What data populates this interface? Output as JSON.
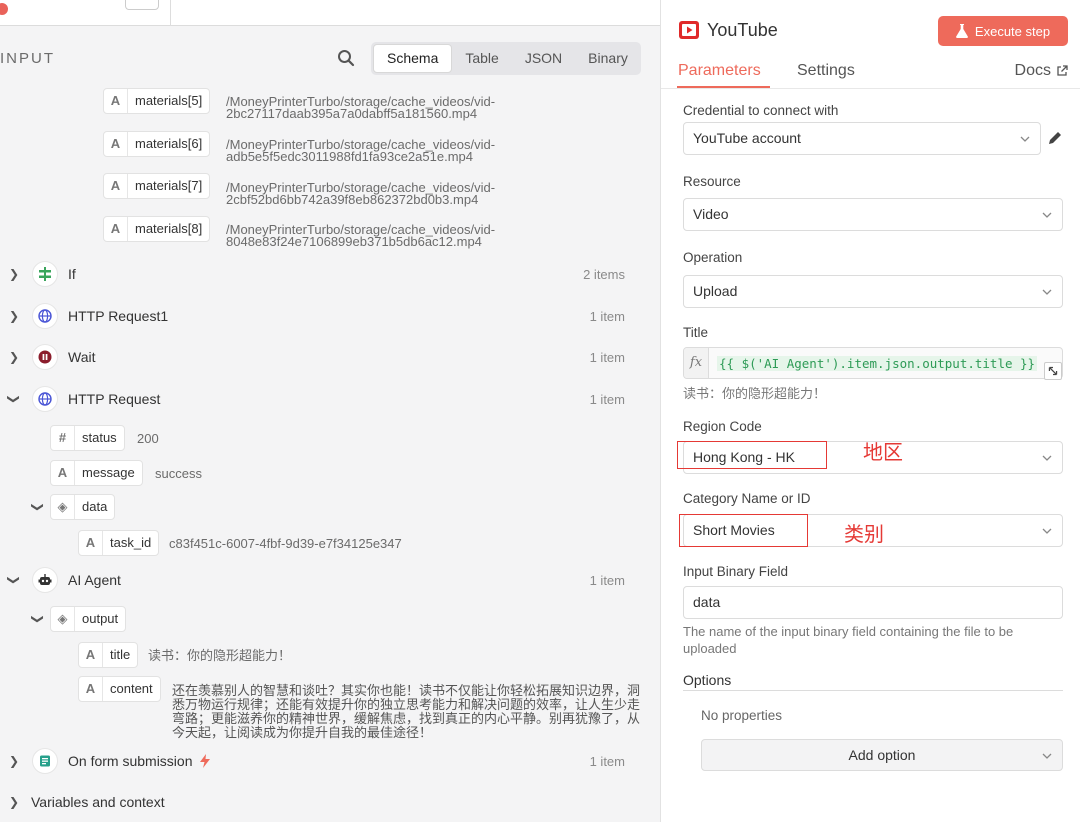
{
  "input_panel": {
    "label": "INPUT",
    "view_tabs": [
      "Schema",
      "Table",
      "JSON",
      "Binary"
    ],
    "active_view": "Schema",
    "materials": [
      {
        "key": "materials[5]",
        "line1": "/MoneyPrinterTurbo/storage/cache_videos/vid-",
        "line2": "2bc27117daab395a7a0dabff5a181560.mp4"
      },
      {
        "key": "materials[6]",
        "line1": "/MoneyPrinterTurbo/storage/cache_videos/vid-",
        "line2": "adb5e5f5edc3011988fd1fa93ce2a51e.mp4"
      },
      {
        "key": "materials[7]",
        "line1": "/MoneyPrinterTurbo/storage/cache_videos/vid-",
        "line2": "2cbf52bd6bb742a39f8eb862372bd0b3.mp4"
      },
      {
        "key": "materials[8]",
        "line1": "/MoneyPrinterTurbo/storage/cache_videos/vid-",
        "line2": "8048e83f24e7106899eb371b5db6ac12.mp4"
      }
    ],
    "nodes": {
      "if": {
        "name": "If",
        "count": "2 items"
      },
      "http1": {
        "name": "HTTP Request1",
        "count": "1 item"
      },
      "wait": {
        "name": "Wait",
        "count": "1 item"
      },
      "http": {
        "name": "HTTP Request",
        "count": "1 item"
      },
      "agent": {
        "name": "AI Agent",
        "count": "1 item"
      },
      "form": {
        "name": "On form submission",
        "count": "1 item"
      }
    },
    "http_fields": {
      "status_key": "status",
      "status_val": "200",
      "message_key": "message",
      "message_val": "success",
      "data_key": "data",
      "task_id_key": "task_id",
      "task_id_val": "c83f451c-6007-4fbf-9d39-e7f34125e347"
    },
    "agent_fields": {
      "output_key": "output",
      "title_key": "title",
      "title_val": "读书：你的隐形超能力！",
      "content_key": "content",
      "content_val": "还在羡慕别人的智慧和谈吐？其实你也能！读书不仅能让你轻松拓展知识边界，洞悉万物运行规律；还能有效提升你的独立思考能力和解决问题的效率，让人生少走弯路；更能滋养你的精神世界，缓解焦虑，找到真正的内心平静。别再犹豫了，从今天起，让阅读成为你提升自我的最佳途径！"
    },
    "variables_label": "Variables and context"
  },
  "node_panel": {
    "title": "YouTube",
    "execute_label": "Execute step",
    "tabs": {
      "parameters": "Parameters",
      "settings": "Settings",
      "docs": "Docs"
    },
    "credential": {
      "label": "Credential to connect with",
      "value": "YouTube account"
    },
    "resource": {
      "label": "Resource",
      "value": "Video"
    },
    "operation": {
      "label": "Operation",
      "value": "Upload"
    },
    "title_field": {
      "label": "Title",
      "expression": "{{ $('AI Agent').item.json.output.title }}",
      "preview": "读书：你的隐形超能力！"
    },
    "region": {
      "label": "Region Code",
      "value": "Hong Kong - HK",
      "annotation": "地区"
    },
    "category": {
      "label": "Category Name or ID",
      "value": "Short Movies",
      "annotation": "类别"
    },
    "binary_field": {
      "label": "Input Binary Field",
      "value": "data",
      "hint": "The name of the input binary field containing the file to be uploaded"
    },
    "options": {
      "label": "Options",
      "empty": "No properties",
      "add_label": "Add option"
    }
  },
  "colors": {
    "accent": "#ee6a5b",
    "annotation_red": "#e53935",
    "expression_green": "#2e9b56"
  }
}
